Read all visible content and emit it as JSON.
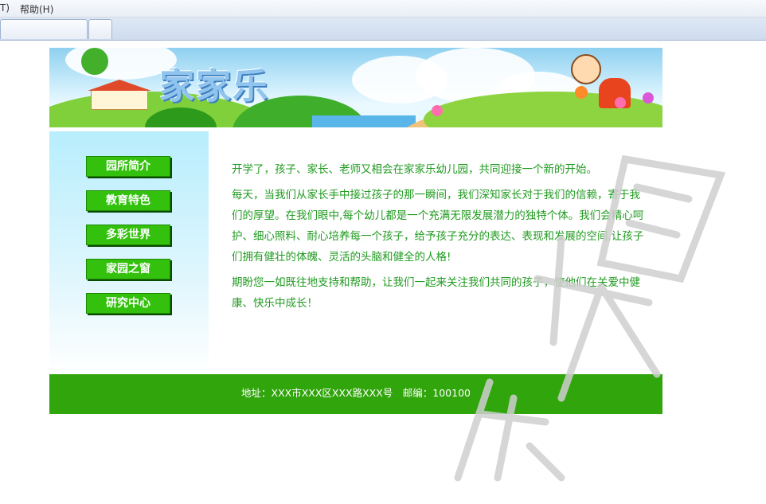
{
  "browser": {
    "menu_fragment": "T)",
    "menu_help": "帮助(H)"
  },
  "banner": {
    "site_title": "家家乐"
  },
  "nav": {
    "items": [
      {
        "label": "园所简介"
      },
      {
        "label": "教育特色"
      },
      {
        "label": "多彩世界"
      },
      {
        "label": "家园之窗"
      },
      {
        "label": "研究中心"
      }
    ]
  },
  "content": {
    "paragraphs": [
      "开学了，孩子、家长、老师又相会在家家乐幼儿园，共同迎接一个新的开始。",
      "每天，当我们从家长手中接过孩子的那一瞬间，我们深知家长对于我们的信赖，寄于我们的厚望。在我们眼中,每个幼儿都是一个充满无限发展潜力的独特个体。我们会精心呵护、细心照料、耐心培养每一个孩子，给予孩子充分的表达、表现和发展的空间,让孩子们拥有健壮的体魄、灵活的头脑和健全的人格!",
      "期盼您一如既往地支持和帮助，让我们一起来关注我们共同的孩子，使他们在关爱中健康、快乐中成长！"
    ]
  },
  "footer": {
    "address": "地址：XXX市XXX区XXX路XXX号　邮编：100100"
  },
  "colors": {
    "nav_button": "#33c10d",
    "text_green": "#1f9a1f",
    "footer_bg": "#31a50c",
    "sidebar_top": "#b8eefd"
  }
}
